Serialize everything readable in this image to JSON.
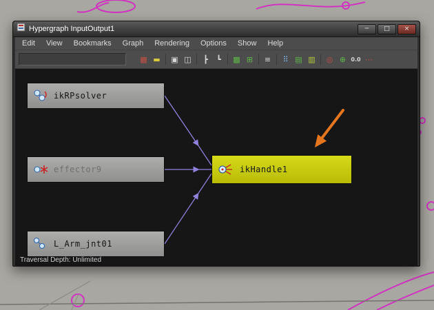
{
  "window": {
    "title": "Hypergraph InputOutput1",
    "controls": {
      "minimize_glyph": "─",
      "maximize_glyph": "□",
      "close_glyph": "×"
    },
    "menu": {
      "items": [
        "Edit",
        "View",
        "Bookmarks",
        "Graph",
        "Rendering",
        "Options",
        "Show",
        "Help"
      ]
    },
    "toolbar": {
      "field_value": "",
      "icons": [
        {
          "name": "toggle-connectivity-icon",
          "glyph": "▦"
        },
        {
          "name": "toggle-shapes-icon",
          "glyph": "▬"
        },
        {
          "name": "frame-all-icon",
          "glyph": "▣"
        },
        {
          "name": "frame-selection-icon",
          "glyph": "◫"
        },
        {
          "name": "layout-hierarchy-icon",
          "glyph": "┣"
        },
        {
          "name": "layout-tree-icon",
          "glyph": "┗"
        },
        {
          "name": "graph-upstream-icon",
          "glyph": "▩"
        },
        {
          "name": "graph-downstream-icon",
          "glyph": "⊞"
        },
        {
          "name": "list-view-icon",
          "glyph": "≡"
        },
        {
          "name": "show-dots-icon",
          "glyph": "⠿"
        },
        {
          "name": "layout-freeform-icon",
          "glyph": "▤"
        },
        {
          "name": "layout-automatic-icon",
          "glyph": "▥"
        },
        {
          "name": "target-icon",
          "glyph": "◎"
        },
        {
          "name": "grid-crosshair-icon",
          "glyph": "⊕"
        },
        {
          "name": "precision-display-icon",
          "glyph": "0.0"
        },
        {
          "name": "options-dots-icon",
          "glyph": "⋯"
        }
      ]
    },
    "status_text": "Traversal Depth: Unlimited"
  },
  "graph": {
    "nodes": [
      {
        "label": "ikRPsolver",
        "state": "normal"
      },
      {
        "label": "effector9",
        "state": "dimmed"
      },
      {
        "label": "L_Arm_jnt01",
        "state": "normal"
      },
      {
        "label": "ikHandle1",
        "state": "selected"
      }
    ],
    "colors": {
      "node": "#9e9e9c",
      "selected_node": "#c9cf10",
      "connection": "#8f81de",
      "canvas": "#161616"
    }
  },
  "annotation": {
    "arrow_color": "#e5761e"
  },
  "desktop": {
    "background": "#a9a7a1",
    "curve_color": "#d81ec8"
  }
}
